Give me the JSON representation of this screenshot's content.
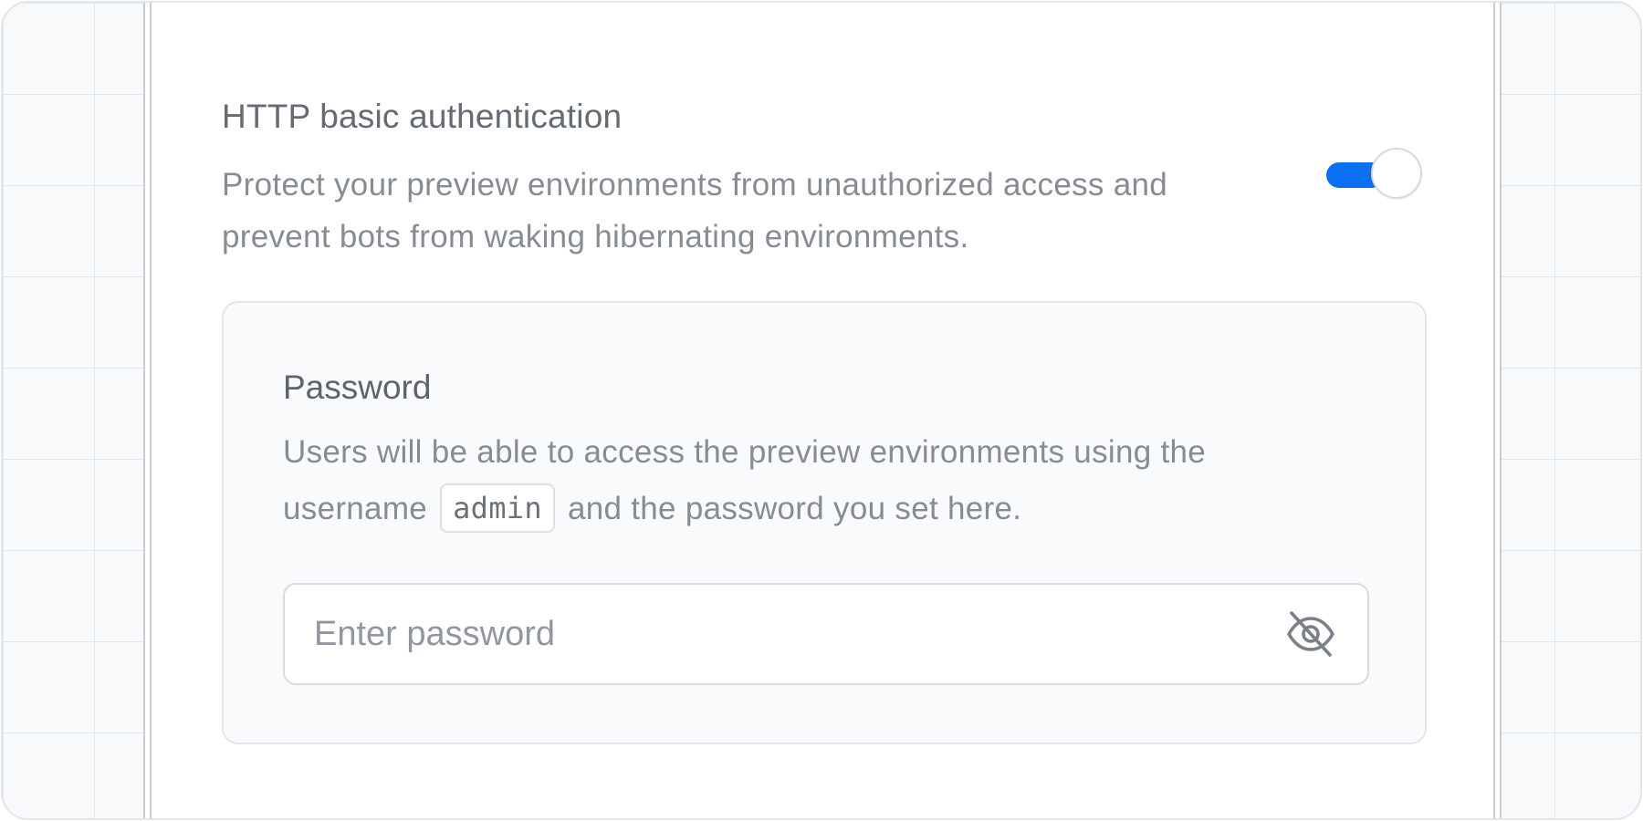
{
  "auth": {
    "title": "HTTP basic authentication",
    "description": "Protect your preview environments from unauthorized access and prevent bots from waking hibernating environments.",
    "enabled": true,
    "accent_color": "#0a6ff0"
  },
  "password": {
    "title": "Password",
    "description_before": "Users will be able to access the preview environments using the username",
    "username": "admin",
    "description_after": "and the password you set here.",
    "placeholder": "Enter password",
    "value": "",
    "visibility_icon": "eye-off-icon"
  }
}
